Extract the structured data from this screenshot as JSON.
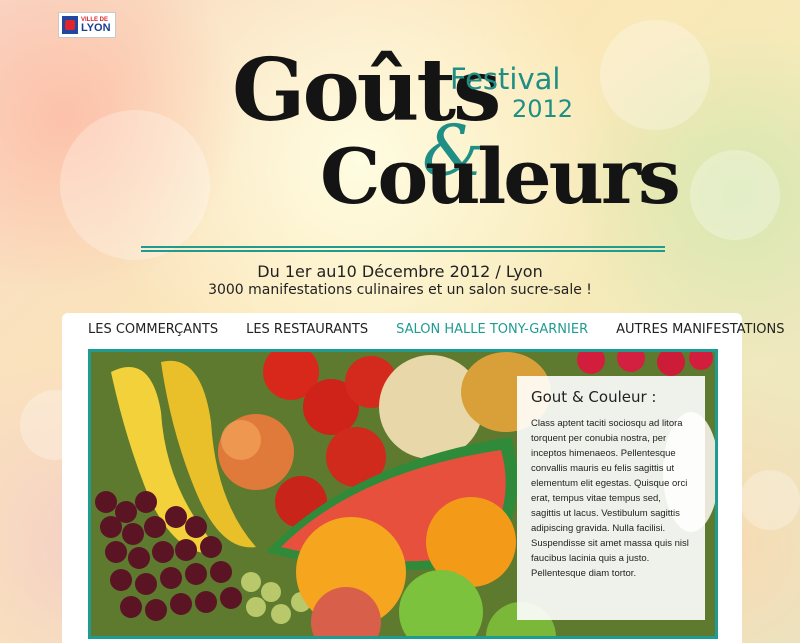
{
  "brand": {
    "city_small": "VILLE DE",
    "city_big": "LYON"
  },
  "title": {
    "line1": "Goûts",
    "ampersand": "&",
    "line2": "Couleurs",
    "festival": "Festival",
    "year": "2012"
  },
  "event": {
    "dates": "Du 1er au10 Décembre 2012 / Lyon",
    "subtitle": "3000 manifestations culinaires et un salon sucre-sale !"
  },
  "nav": {
    "items": [
      {
        "label": "LES COMMERÇANTS",
        "active": false
      },
      {
        "label": "LES RESTAURANTS",
        "active": false
      },
      {
        "label": "SALON HALLE TONY-GARNIER",
        "active": true
      },
      {
        "label": "AUTRES MANIFESTATIONS",
        "active": false
      }
    ]
  },
  "content": {
    "heading": "Gout & Couleur :",
    "body": "Class aptent taciti sociosqu ad litora torquent per conubia nostra, per inceptos himenaeos. Pellentesque convallis mauris eu felis sagittis ut elementum elit egestas. Quisque orci erat, tempus vitae tempus sed, sagittis ut lacus. Vestibulum sagittis adipiscing gravida. Nulla facilisi. Suspendisse sit amet massa quis nisl faucibus lacinia quis a justo. Pellentesque diam tortor."
  },
  "colors": {
    "accent": "#1f9c92",
    "text": "#222222"
  }
}
